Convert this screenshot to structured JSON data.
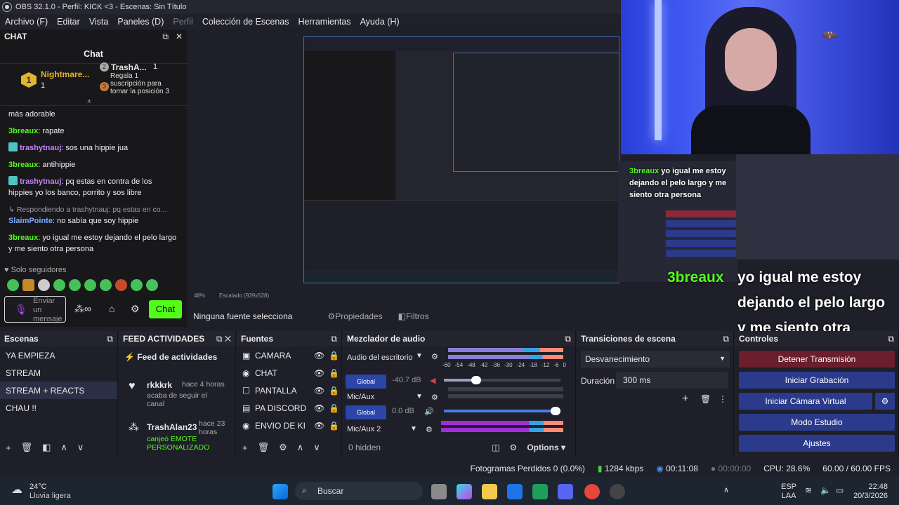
{
  "window": {
    "title": "OBS 32.1.0 - Perfil: KICK <3 - Escenas: Sin Título"
  },
  "menu": [
    "Archivo (F)",
    "Editar",
    "Vista",
    "Paneles (D)",
    "Perfil",
    "Colección de Escenas",
    "Herramientas",
    "Ayuda (H)"
  ],
  "chat_dock": {
    "dock_title": "CHAT",
    "title": "Chat",
    "pinned": {
      "rank": "1",
      "name": "Nightmare...",
      "count": "1",
      "rank2": "2",
      "name2": "TrashA...",
      "count2": "1",
      "rank3": "3",
      "gift_text": "Regala 1 suscripción para tomar la posición 3"
    },
    "messages": [
      {
        "user": "",
        "text": "más adorable"
      },
      {
        "user": "3breaux",
        "text": "rapate"
      },
      {
        "user": "trashytnauj",
        "text": "sos una hippie jua",
        "badge": true
      },
      {
        "user": "3breaux",
        "text": "antihippie"
      },
      {
        "user": "trashytnauj",
        "text": "pq estas en contra de los hippies yo los banco, porrito y sos libre",
        "badge": true
      },
      {
        "reply": "Respondiendo a trashytnauj: pq estas en co...",
        "user": "SlaimPointe",
        "text": "no sabía que soy hippie"
      },
      {
        "user": "3breaux",
        "text": "yo igual me estoy dejando el pelo largo y me siento otra persona"
      }
    ],
    "followers_only": "Solo seguidores",
    "input_placeholder": "Enviar un mensaje",
    "send_label": "Chat"
  },
  "preview": {
    "overlay_user": "3breaux",
    "overlay_msg": "yo igual me estoy dejando el pelo largo y me siento otra persona",
    "small_overlay_user": "3breaux",
    "small_overlay_msg": "yo igual me estoy dejando el pelo largo y me siento otra persona",
    "zoom": "48%",
    "scaling": "Escalado (939x528)"
  },
  "source_bar": {
    "no_source": "Ninguna fuente selecciona",
    "properties": "Propiedades",
    "filters": "Filtros"
  },
  "scenes": {
    "title": "Escenas",
    "items": [
      "YA EMPIEZA",
      "STREAM",
      "STREAM + REACTS",
      "CHAU !!"
    ],
    "selected": 2
  },
  "activity": {
    "title": "FEED ACTIVIDADES",
    "header": "Feed de actividades",
    "items": [
      {
        "user": "rkkkrk",
        "time": "hace 4 horas",
        "desc": "acaba de seguir el canal"
      },
      {
        "user": "TrashAlan23",
        "time": "hace 23 horas",
        "desc": "canjeó EMOTE PERSONALIZADO"
      }
    ]
  },
  "sources": {
    "title": "Fuentes",
    "items": [
      "CAMARA",
      "CHAT",
      "PANTALLA",
      "PA DISCORD",
      "ENVIO DE KI"
    ]
  },
  "mixer": {
    "title": "Mezclador de audio",
    "channels": [
      {
        "name": "Audio del escritorio",
        "global": "Global",
        "db": "-40.7 dB",
        "level": 0.28
      },
      {
        "name": "Mic/Aux",
        "global": "Global",
        "db": "0.0 dB",
        "level": 1.0
      },
      {
        "name": "Mic/Aux 2"
      }
    ],
    "ticks": [
      "-60",
      "-54",
      "-48",
      "-42",
      "-36",
      "-30",
      "-24",
      "-18",
      "-12",
      "-6",
      "0"
    ],
    "hidden": "0 hidden",
    "options": "Options"
  },
  "transitions": {
    "title": "Transiciones de escena",
    "type": "Desvanecimiento",
    "duration_label": "Duración",
    "duration": "300 ms"
  },
  "controls": {
    "title": "Controles",
    "stop": "Detener Transmisión",
    "record": "Iniciar Grabación",
    "virtualcam": "Iniciar Cámara Virtual",
    "studio": "Modo Estudio",
    "settings": "Ajustes"
  },
  "statusbar": {
    "dropped": "Fotogramas Perdidos 0 (0.0%)",
    "kbps": "1284 kbps",
    "live": "00:11:08",
    "rec": "00:00:00",
    "cpu": "CPU: 28.6%",
    "fps": "60.00 / 60.00 FPS"
  },
  "taskbar": {
    "temp": "24°C",
    "weather": "Lluvia ligera",
    "search": "Buscar",
    "lang": "ESP",
    "lang2": "LAA",
    "time": "22:48",
    "date": "20/3/2026"
  },
  "colors": {
    "kick_green": "#53fc18",
    "accent_blue": "#2c3a8c",
    "bg": "#1e1f29"
  }
}
